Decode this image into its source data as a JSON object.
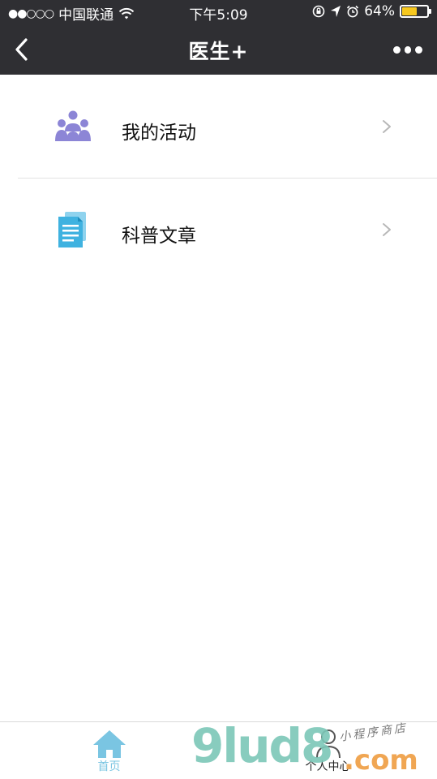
{
  "status_bar": {
    "signal": "●●○○○",
    "carrier": "中国联通",
    "time": "下午5:09",
    "battery_percent": "64%",
    "battery_level": 0.64,
    "battery_color": "#f7c81e"
  },
  "nav": {
    "title": "医生+",
    "back_icon": "chevron-left-icon",
    "more_icon": "more-dots-icon"
  },
  "menu": {
    "items": [
      {
        "label": "我的活动",
        "icon": "people-group-icon",
        "icon_color": "#8c85d6"
      },
      {
        "label": "科普文章",
        "icon": "document-icon",
        "icon_color": "#3fb2e0"
      }
    ]
  },
  "tabbar": {
    "tabs": [
      {
        "label": "首页",
        "icon": "home-icon",
        "active": true,
        "color": "#7ac5e2"
      },
      {
        "label": "个人中心",
        "icon": "person-icon",
        "active": false,
        "color": "#222222"
      }
    ]
  },
  "watermark": {
    "brand": "9lud8",
    "suffix": ".com",
    "tagline": "小程序商店"
  }
}
